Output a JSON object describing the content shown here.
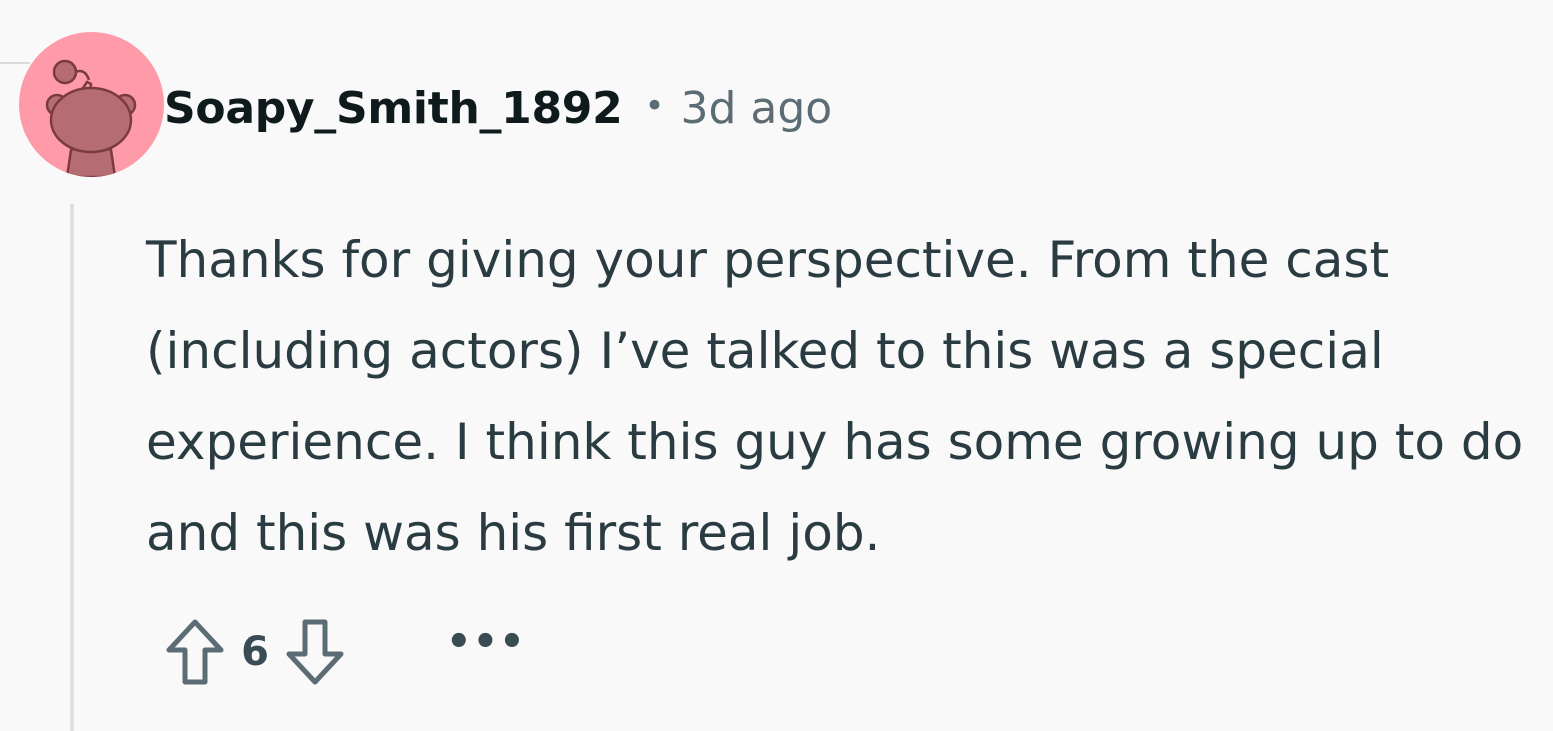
{
  "comment": {
    "author": "Soapy_Smith_1892",
    "separator": "•",
    "time_ago": "3d ago",
    "body": "Thanks for giving your perspective. From the cast (including actors) I’ve talked to this was a special experience. I think this guy has some growing up to do and this was his first real job.",
    "score": "6",
    "more_label": "•••"
  },
  "icons": {
    "avatar": "snoo-avatar-icon",
    "upvote": "upvote-arrow-icon",
    "downvote": "downvote-arrow-icon",
    "more": "overflow-menu-icon"
  },
  "colors": {
    "background": "#f9f9fa",
    "avatar_bg": "#ff9aa9",
    "author_text": "#0f1a1c",
    "muted_text": "#5c6c74",
    "body_text": "#2a3c42",
    "thread_line": "#dde0e4"
  }
}
